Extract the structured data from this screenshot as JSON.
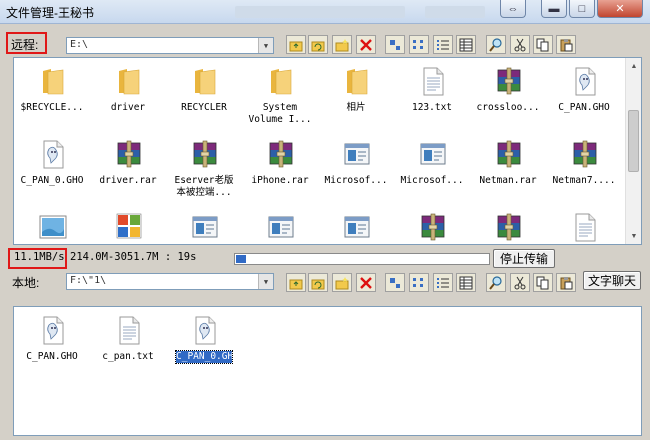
{
  "window": {
    "title": "文件管理-王秘书"
  },
  "remote": {
    "label": "远程:",
    "path": "E:\\",
    "items": [
      {
        "name": "$RECYCLE...",
        "icon": "folder-icon"
      },
      {
        "name": "driver",
        "icon": "folder-icon"
      },
      {
        "name": "RECYCLER",
        "icon": "folder-icon"
      },
      {
        "name": "System\nVolume I...",
        "icon": "folder-icon"
      },
      {
        "name": "相片",
        "icon": "folder-icon"
      },
      {
        "name": "123.txt",
        "icon": "text-file-icon"
      },
      {
        "name": "crossloo...",
        "icon": "rar-archive-icon"
      },
      {
        "name": "C_PAN.GHO",
        "icon": "ghost-file-icon"
      },
      {
        "name": "C_PAN_0.GHO",
        "icon": "ghost-file-icon"
      },
      {
        "name": "driver.rar",
        "icon": "rar-archive-icon"
      },
      {
        "name": "Eserver老版\n本被控端...",
        "icon": "rar-archive-icon"
      },
      {
        "name": "iPhone.rar",
        "icon": "rar-archive-icon"
      },
      {
        "name": "Microsof...",
        "icon": "installer-icon"
      },
      {
        "name": "Microsof...",
        "icon": "installer-icon"
      },
      {
        "name": "Netman.rar",
        "icon": "rar-archive-icon"
      },
      {
        "name": "Netman7....",
        "icon": "rar-archive-icon"
      },
      {
        "name": "",
        "icon": "image-file-icon"
      },
      {
        "name": "",
        "icon": "office-icon"
      },
      {
        "name": "",
        "icon": "installer-icon"
      },
      {
        "name": "",
        "icon": "installer-icon"
      },
      {
        "name": "",
        "icon": "installer-icon"
      },
      {
        "name": "",
        "icon": "rar-archive-icon"
      },
      {
        "name": "",
        "icon": "rar-archive-icon"
      },
      {
        "name": "",
        "icon": "text-file-icon"
      }
    ]
  },
  "transfer": {
    "speed": "11.1MB/s",
    "info": "214.0M-3051.7M : 19s",
    "progress": 0.04,
    "stop_label": "停止传输"
  },
  "local": {
    "label": "本地:",
    "path": "F:\\\"1\\",
    "chat_label": "文字聊天",
    "items": [
      {
        "name": "C_PAN.GHO",
        "icon": "ghost-file-icon",
        "selected": false
      },
      {
        "name": "c_pan.txt",
        "icon": "text-file-icon",
        "selected": false
      },
      {
        "name": "C_PAN_0.GHO",
        "icon": "ghost-file-icon",
        "selected": true
      }
    ]
  },
  "toolbar_icons": [
    "up-folder-icon",
    "refresh-icon",
    "new-folder-icon",
    "delete-icon",
    "large-icons-view-icon",
    "small-icons-view-icon",
    "list-view-icon",
    "details-view-icon",
    "search-icon",
    "cut-icon",
    "copy-icon",
    "paste-icon"
  ],
  "colors": {
    "highlight": "#316ac5",
    "annotation_red": "#e01818",
    "folder": "#f3c85a"
  }
}
